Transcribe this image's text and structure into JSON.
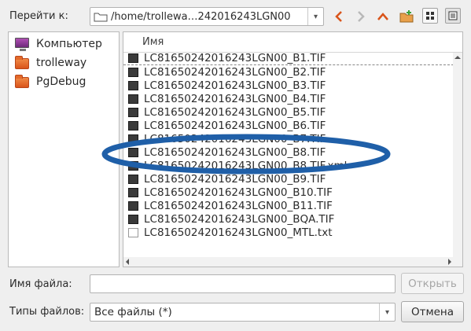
{
  "toolbar": {
    "goto_label": "Перейти к:",
    "path": "/home/trollewa…242016243LGN00",
    "dropdown_glyph": "▾"
  },
  "sidebar": {
    "items": [
      {
        "label": "Компьютер",
        "icon": "computer-icon"
      },
      {
        "label": "trolleway",
        "icon": "folder-icon"
      },
      {
        "label": "PgDebug",
        "icon": "folder-icon"
      }
    ]
  },
  "filelist": {
    "column_name": "Имя",
    "files": [
      {
        "name": "LC81650242016243LGN00_B1.TIF",
        "icon": "image-file-icon"
      },
      {
        "name": "LC81650242016243LGN00_B2.TIF",
        "icon": "image-file-icon"
      },
      {
        "name": "LC81650242016243LGN00_B3.TIF",
        "icon": "image-file-icon"
      },
      {
        "name": "LC81650242016243LGN00_B4.TIF",
        "icon": "image-file-icon"
      },
      {
        "name": "LC81650242016243LGN00_B5.TIF",
        "icon": "image-file-icon"
      },
      {
        "name": "LC81650242016243LGN00_B6.TIF",
        "icon": "image-file-icon"
      },
      {
        "name": "LC81650242016243LGN00_B7.TIF",
        "icon": "image-file-icon"
      },
      {
        "name": "LC81650242016243LGN00_B8.TIF",
        "icon": "image-file-icon"
      },
      {
        "name": "LC81650242016243LGN00_B8.TIF.xml",
        "icon": "image-file-icon"
      },
      {
        "name": "LC81650242016243LGN00_B9.TIF",
        "icon": "image-file-icon"
      },
      {
        "name": "LC81650242016243LGN00_B10.TIF",
        "icon": "image-file-icon"
      },
      {
        "name": "LC81650242016243LGN00_B11.TIF",
        "icon": "image-file-icon"
      },
      {
        "name": "LC81650242016243LGN00_BQA.TIF",
        "icon": "image-file-icon"
      },
      {
        "name": "LC81650242016243LGN00_MTL.txt",
        "icon": "text-file-icon"
      }
    ]
  },
  "bottom": {
    "filename_label": "Имя файла:",
    "filename_value": "",
    "open_button": "Открыть",
    "filetype_label": "Типы файлов:",
    "filetype_value": "Все файлы (*)",
    "cancel_button": "Отмена"
  },
  "colors": {
    "annotation_ellipse": "#1f5fa8",
    "nav_arrow": "#d9541a",
    "folder": "#e36a2a"
  }
}
